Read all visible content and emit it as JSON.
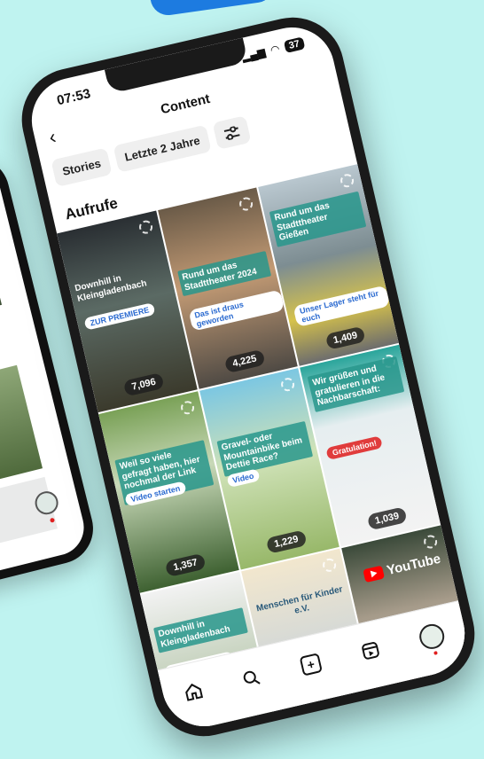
{
  "status": {
    "time": "07:53",
    "battery": "37"
  },
  "header": {
    "title": "Content",
    "back_icon": "chevron-left-icon"
  },
  "filters": {
    "stories_label": "Stories",
    "range_label": "Letzte 2 Jahre",
    "settings_icon": "sliders-icon"
  },
  "section": {
    "title": "Aufrufe"
  },
  "posts": [
    {
      "count": "7,096",
      "caption": "Downhill in Kleingladenbach",
      "pill": "ZUR PREMIERE"
    },
    {
      "count": "4,225",
      "caption": "Rund um das Stadttheater 2024",
      "pill": "Das ist draus geworden"
    },
    {
      "count": "1,409",
      "caption": "Rund um das Stadttheater Gießen",
      "pill": "Unser Lager steht für euch"
    },
    {
      "count": "1,357",
      "caption": "Weil so viele gefragt haben, hier nochmal der Link zum ...",
      "pill": "Video starten"
    },
    {
      "count": "1,229",
      "caption": "Gravel- oder Mountainbike beim Dettie Race?",
      "pill": "Video"
    },
    {
      "count": "1,039",
      "caption": "Wir grüßen und gratulieren in die Nachbarschaft:",
      "pill": "Gratulation!"
    },
    {
      "count": "",
      "caption": "Downhill in Kleingladenbach",
      "pill": "Video schauen!"
    },
    {
      "count": "",
      "caption": "Menschen für Kinder e.V.",
      "pill": ""
    },
    {
      "count": "",
      "caption": "YouTube",
      "pill": ""
    }
  ],
  "bottom_nav": [
    "home-icon",
    "search-icon",
    "create-icon",
    "reels-icon",
    "profile-avatar"
  ]
}
